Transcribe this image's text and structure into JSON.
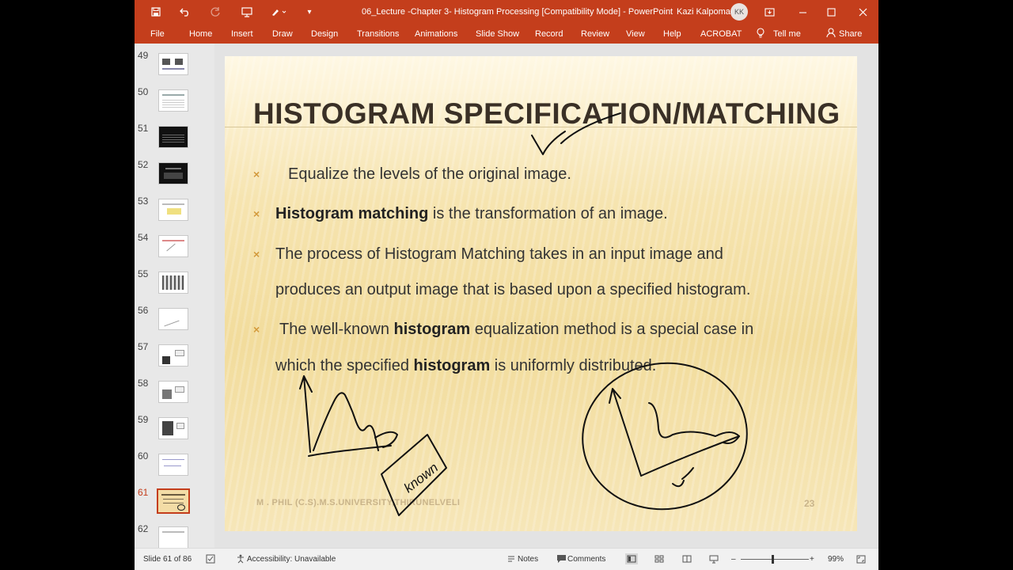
{
  "app": {
    "title": "06_Lecture -Chapter 3- Histogram Processing [Compatibility Mode]  -  PowerPoint",
    "user_name": "Kazi Kalpoma",
    "user_initials": "KK"
  },
  "quick_access": {
    "save_icon": "save-icon",
    "undo_icon": "undo-icon",
    "redo_icon": "redo-icon",
    "present_icon": "present-icon",
    "pen_icon": "pen-icon",
    "customize_icon": "customize-icon"
  },
  "ribbon": {
    "tabs": [
      "File",
      "Home",
      "Insert",
      "Draw",
      "Design",
      "Transitions",
      "Animations",
      "Slide Show",
      "Record",
      "Review",
      "View",
      "Help",
      "ACROBAT"
    ],
    "tell_me": "Tell me",
    "share": "Share"
  },
  "thumbnails": {
    "numbers": [
      "49",
      "50",
      "51",
      "52",
      "53",
      "54",
      "55",
      "56",
      "57",
      "58",
      "59",
      "60",
      "61",
      "62"
    ],
    "selected": "61"
  },
  "slide": {
    "title": "HISTOGRAM SPECIFICATION/MATCHING",
    "bullet_1": "Equalize the levels of the original image.",
    "bullet_2_bold": "Histogram matching",
    "bullet_2_rest": " is the transformation of an image.",
    "bullet_3_line1": "The process of Histogram Matching takes in an input image and",
    "bullet_3_line2": "produces an output image that is based upon a specified histogram.",
    "bullet_4_pre": "The well-known ",
    "bullet_4_bold": "histogram",
    "bullet_4_post": " equalization method is a special case in",
    "bullet_4_line2_pre": "which the specified ",
    "bullet_4_line2_bold": "histogram",
    "bullet_4_line2_post": " is uniformly distributed.",
    "footer": "M . PHIL (C.S).M.S.UNIVERSITY,THIRUNELVELI",
    "page_number": "23",
    "handwritten_label": "known"
  },
  "status": {
    "slide_counter": "Slide 61 of 86",
    "accessibility": "Accessibility: Unavailable",
    "notes": "Notes",
    "comments": "Comments",
    "zoom_minus": "–",
    "zoom_plus": "+",
    "zoom": "99%"
  },
  "colors": {
    "accent": "#c43e1c",
    "bullet": "#d39a3b"
  }
}
